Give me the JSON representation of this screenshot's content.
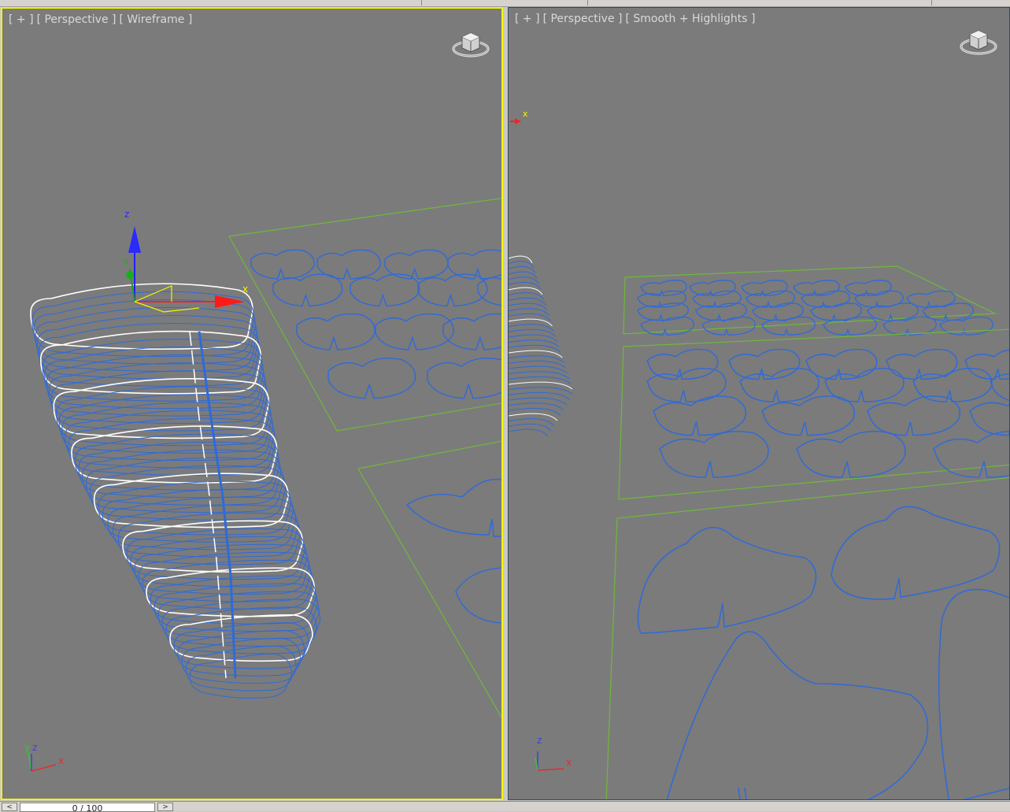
{
  "viewports": {
    "left": {
      "label_parts": [
        "[ + ]",
        "[ Perspective ]",
        "[ Wireframe ]"
      ],
      "active": true,
      "border_color": "#f4f400"
    },
    "right": {
      "label_parts": [
        "[ + ]",
        "[ Perspective ]",
        "[ Smooth + Highlights ]"
      ],
      "active": false,
      "border_color": "#3c4652"
    }
  },
  "gizmo_labels": {
    "z": "z",
    "y": "y",
    "x": "x"
  },
  "axis_tripod_left": {
    "y": "y",
    "z": "z",
    "x": "x"
  },
  "axis_tripod_right": {
    "z": "z",
    "x": "x"
  },
  "right_viewport_axis_x": "x",
  "timeline": {
    "prev_label": "<",
    "next_label": ">",
    "frame_text": "0 / 100"
  },
  "colors": {
    "viewport_bg": "#7b7b7b",
    "spline_blue": "#1f5fd6",
    "spline_white": "#ffffff",
    "plane_green": "#6fb83a",
    "label_gray": "#d9d9d9"
  }
}
